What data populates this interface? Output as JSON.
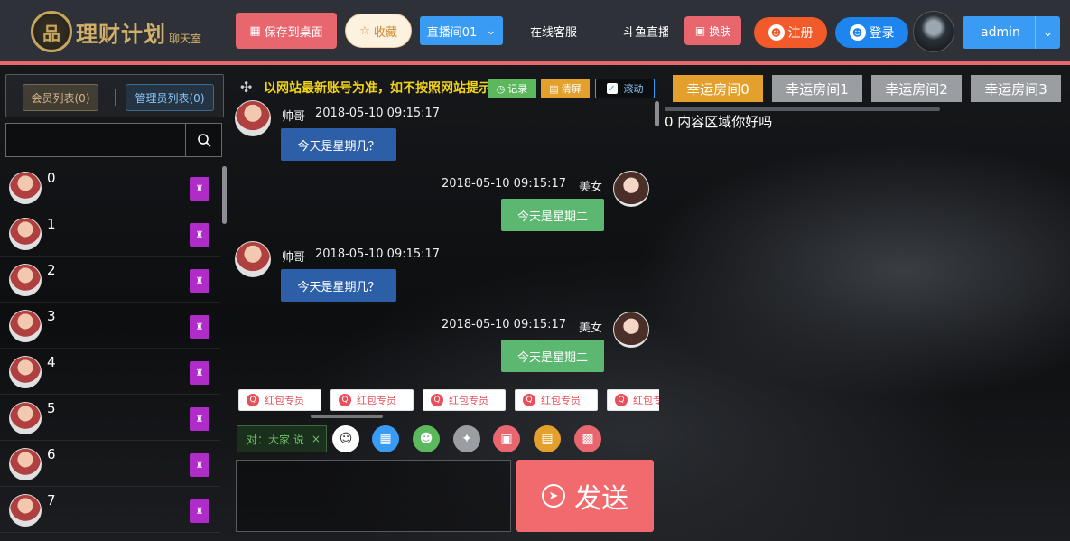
{
  "header": {
    "logo_mark": "品",
    "logo_title": "理财计划",
    "logo_sub": "聊天室",
    "save_desktop": "保存到桌面",
    "favorite": "收藏",
    "live_room": "直播间01",
    "online_service": "在线客服",
    "douyu": "斗鱼直播",
    "skin": "换肤",
    "register": "注册",
    "login": "登录",
    "admin": "admin",
    "colors": {
      "header_bg": "#2e3238",
      "accent": "#e8676e",
      "blue": "#3a9bf4",
      "orange": "#f25a2a"
    }
  },
  "left": {
    "tab_members": "会员列表(0)",
    "tab_admins": "管理员列表(0)",
    "search_placeholder": "",
    "users": [
      "0",
      "1",
      "2",
      "3",
      "4",
      "5",
      "6",
      "7"
    ]
  },
  "center": {
    "notice": "以网站最新账号为准，如不按照网站提示",
    "record": "记录",
    "clear": "清屏",
    "scroll": "滚动",
    "messages": [
      {
        "side": "left",
        "name": "帅哥",
        "time": "2018-05-10 09:15:17",
        "text": "今天是星期几？"
      },
      {
        "side": "right",
        "name": "美女",
        "time": "2018-05-10 09:15:17",
        "text": "今天是星期二"
      },
      {
        "side": "left",
        "name": "帅哥",
        "time": "2018-05-10 09:15:17",
        "text": "今天是星期几？"
      },
      {
        "side": "right",
        "name": "美女",
        "time": "2018-05-10 09:15:17",
        "text": "今天是星期二"
      }
    ],
    "redpack_label": "红包专员",
    "to_label": "对：大家 说",
    "to_close": "×",
    "send": "发送"
  },
  "right": {
    "rooms": [
      "幸运房间0",
      "幸运房间1",
      "幸运房间2",
      "幸运房间3"
    ],
    "content": "0 内容区域你好吗"
  }
}
